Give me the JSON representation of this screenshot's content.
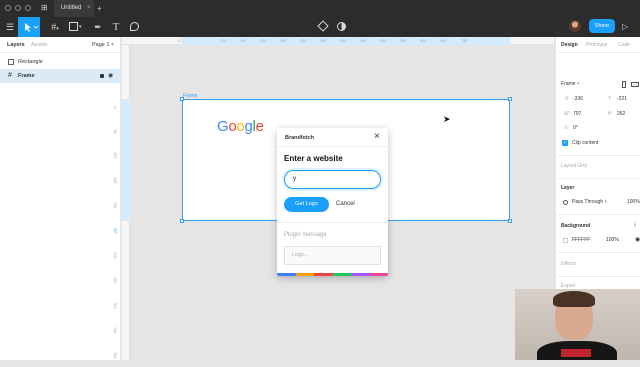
{
  "window": {
    "tab_title": "Untitled",
    "new_tab": "+"
  },
  "toolbar": {
    "share_label": "Share",
    "play_icon": "▷"
  },
  "left_panel": {
    "tabs": [
      "Layers",
      "Assets"
    ],
    "page": "Page 1",
    "layers": [
      {
        "name": "Rectangle",
        "icon": "rectangle-icon"
      },
      {
        "name": "Frame",
        "icon": "frame-icon"
      }
    ]
  },
  "rulers": {
    "h": [
      "0",
      "100",
      "150",
      "200",
      "250",
      "300",
      "350",
      "400",
      "450",
      "500",
      "550",
      "600",
      "650",
      "707"
    ],
    "v": [
      "0",
      "50",
      "100",
      "150",
      "200",
      "262",
      "300",
      "350",
      "400",
      "450",
      "500",
      "550"
    ]
  },
  "canvas": {
    "frame_label": "Frame",
    "logo": [
      "G",
      "o",
      "o",
      "g",
      "l",
      "e"
    ],
    "logo_colors": [
      "#4285f4",
      "#ea4335",
      "#fbbc05",
      "#4285f4",
      "#34a853",
      "#ea4335"
    ]
  },
  "plugin": {
    "title": "Brandfetch",
    "heading": "Enter a website",
    "input_value": "y",
    "primary_button": "Get Logo",
    "cancel_button": "Cancel",
    "message_label": "Plugin message",
    "logs_placeholder": "Logs...",
    "stripe_colors": [
      "#3b82f6",
      "#f59e0b",
      "#ef4444",
      "#22c55e",
      "#a855f7",
      "#ec4899"
    ]
  },
  "right_panel": {
    "tabs": [
      "Design",
      "Prototype",
      "Code"
    ],
    "frame_label": "Frame",
    "x_label": "X",
    "x_value": "-336",
    "y_label": "Y",
    "y_value": "-221",
    "w_label": "W",
    "w_value": "707",
    "h_label": "H",
    "h_value": "262",
    "rotation": "0°",
    "clip_content": "Clip content",
    "layout_grid": "Layout Grid",
    "layer_label": "Layer",
    "blend": "Pass Through",
    "opacity": "100%",
    "background_label": "Background",
    "bg_hex": "FFFFFF",
    "bg_opacity": "100%",
    "effects": "Effects",
    "export": "Export"
  },
  "colors": {
    "accent": "#18a0fb",
    "selection": "#3aa0f5"
  }
}
